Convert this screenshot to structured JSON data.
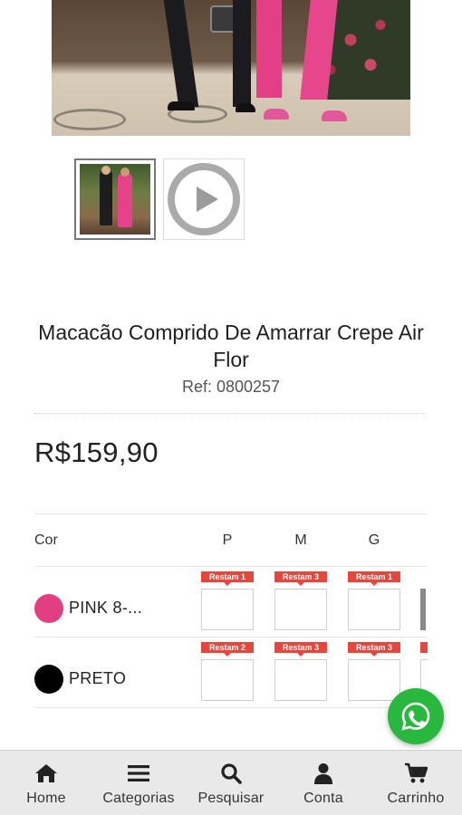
{
  "product": {
    "title": "Macacão Comprido De Amarrar Crepe Air Flor",
    "ref": "Ref: 0800257",
    "price": "R$159,90"
  },
  "grade": {
    "color_header": "Cor",
    "sizes": [
      "P",
      "M",
      "G"
    ],
    "rows": [
      {
        "name": "PINK 8-...",
        "swatch": "#e23f82",
        "badges": [
          "Restam 1",
          "Restam 3",
          "Restam 1"
        ]
      },
      {
        "name": "PRETO",
        "swatch": "#000000",
        "badges": [
          "Restam 2",
          "Restam 3",
          "Restam 3"
        ]
      }
    ]
  },
  "nav": {
    "items": [
      {
        "label": "Home",
        "icon": "home-icon"
      },
      {
        "label": "Categorias",
        "icon": "menu-icon"
      },
      {
        "label": "Pesquisar",
        "icon": "search-icon"
      },
      {
        "label": "Conta",
        "icon": "user-icon"
      },
      {
        "label": "Carrinho",
        "icon": "cart-icon"
      }
    ]
  },
  "colors": {
    "accent_badge": "#e8463d",
    "whatsapp": "#28b83e",
    "nav_bg": "#e9e9e9"
  }
}
